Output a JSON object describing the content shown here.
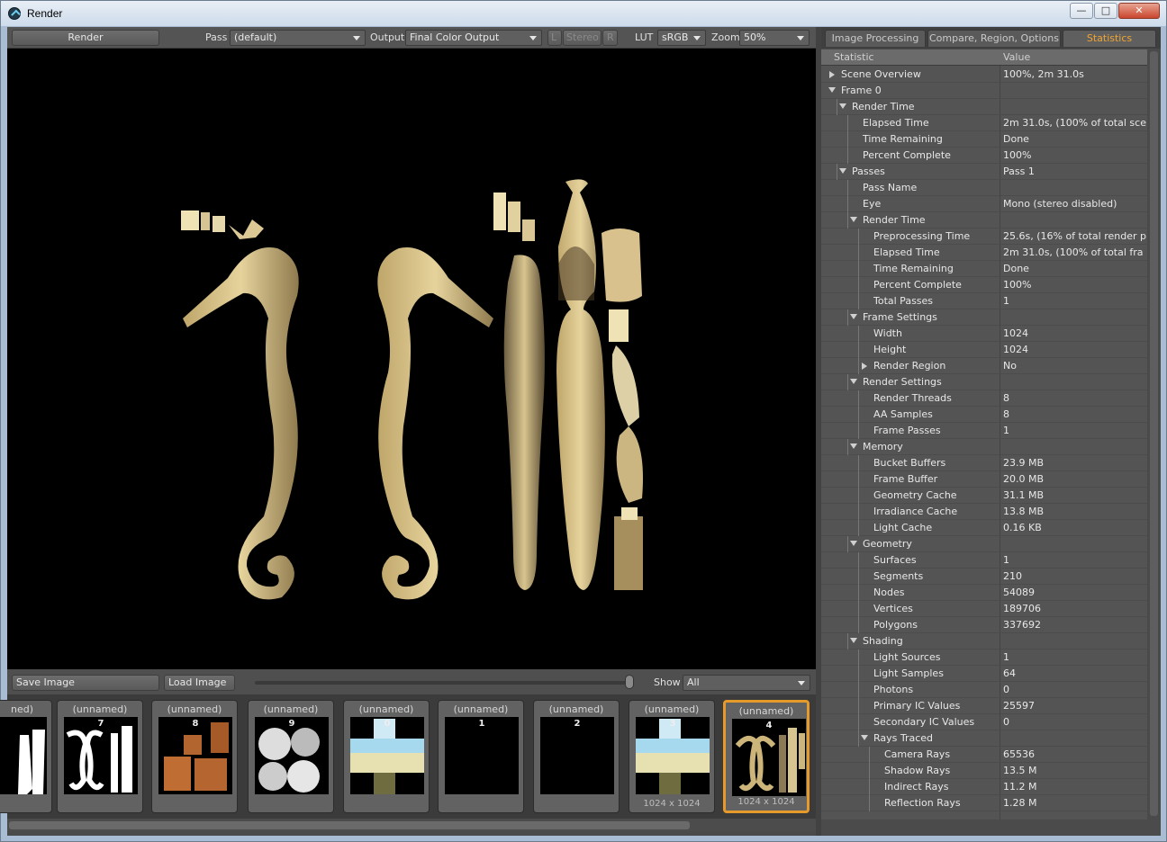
{
  "window": {
    "title": "Render",
    "min": "—",
    "max": "□",
    "close": "✕"
  },
  "toolbar": {
    "render_button": "Render",
    "pass_label": "Pass",
    "pass_value": "(default)",
    "output_label": "Output",
    "output_value": "Final Color Output",
    "l_label": "L",
    "stereo_label": "Stereo",
    "r_label": "R",
    "lut_label": "LUT",
    "lut_value": "sRGB",
    "zoom_label": "Zoom",
    "zoom_value": "50%"
  },
  "bottom": {
    "save": "Save Image",
    "load": "Load Image",
    "show_label": "Show",
    "show_value": "All"
  },
  "thumbnails": [
    {
      "name": "ned)",
      "num": "",
      "size": ""
    },
    {
      "name": "(unnamed)",
      "num": "7",
      "size": ""
    },
    {
      "name": "(unnamed)",
      "num": "8",
      "size": ""
    },
    {
      "name": "(unnamed)",
      "num": "9",
      "size": ""
    },
    {
      "name": "(unnamed)",
      "num": "0",
      "size": ""
    },
    {
      "name": "(unnamed)",
      "num": "1",
      "size": ""
    },
    {
      "name": "(unnamed)",
      "num": "2",
      "size": ""
    },
    {
      "name": "(unnamed)",
      "num": "3",
      "size": "1024 x 1024"
    },
    {
      "name": "(unnamed)",
      "num": "4",
      "size": "1024 x 1024"
    }
  ],
  "tabs": [
    "Image Processing",
    "Compare, Region, Options",
    "Statistics"
  ],
  "stats": {
    "col_stat": "Statistic",
    "col_value": "Value",
    "rows": [
      {
        "label": "Scene Overview",
        "value": "100%, 2m 31.0s",
        "depth": 0,
        "tw": "closed"
      },
      {
        "label": "Frame 0",
        "value": "",
        "depth": 0,
        "tw": "open"
      },
      {
        "label": "Render Time",
        "value": "",
        "depth": 1,
        "tw": "open"
      },
      {
        "label": "Elapsed Time",
        "value": "2m 31.0s, (100% of total sce ...",
        "depth": 2,
        "tw": ""
      },
      {
        "label": "Time Remaining",
        "value": "Done",
        "depth": 2,
        "tw": ""
      },
      {
        "label": "Percent Complete",
        "value": "100%",
        "depth": 2,
        "tw": ""
      },
      {
        "label": "Passes",
        "value": "Pass 1",
        "depth": 1,
        "tw": "open"
      },
      {
        "label": "Pass Name",
        "value": "",
        "depth": 2,
        "tw": ""
      },
      {
        "label": "Eye",
        "value": "Mono (stereo disabled)",
        "depth": 2,
        "tw": ""
      },
      {
        "label": "Render Time",
        "value": "",
        "depth": 2,
        "tw": "open"
      },
      {
        "label": "Preprocessing Time",
        "value": "25.6s, (16% of total render p ...",
        "depth": 3,
        "tw": ""
      },
      {
        "label": "Elapsed Time",
        "value": "2m 31.0s, (100% of total fra ...",
        "depth": 3,
        "tw": ""
      },
      {
        "label": "Time Remaining",
        "value": "Done",
        "depth": 3,
        "tw": ""
      },
      {
        "label": "Percent Complete",
        "value": "100%",
        "depth": 3,
        "tw": ""
      },
      {
        "label": "Total Passes",
        "value": "1",
        "depth": 3,
        "tw": ""
      },
      {
        "label": "Frame Settings",
        "value": "",
        "depth": 2,
        "tw": "open"
      },
      {
        "label": "Width",
        "value": "1024",
        "depth": 3,
        "tw": ""
      },
      {
        "label": "Height",
        "value": "1024",
        "depth": 3,
        "tw": ""
      },
      {
        "label": "Render Region",
        "value": "No",
        "depth": 3,
        "tw": "closed"
      },
      {
        "label": "Render Settings",
        "value": "",
        "depth": 2,
        "tw": "open"
      },
      {
        "label": "Render Threads",
        "value": "8",
        "depth": 3,
        "tw": ""
      },
      {
        "label": "AA Samples",
        "value": "8",
        "depth": 3,
        "tw": ""
      },
      {
        "label": "Frame Passes",
        "value": "1",
        "depth": 3,
        "tw": ""
      },
      {
        "label": "Memory",
        "value": "",
        "depth": 2,
        "tw": "open"
      },
      {
        "label": "Bucket Buffers",
        "value": "23.9 MB",
        "depth": 3,
        "tw": ""
      },
      {
        "label": "Frame Buffer",
        "value": "20.0 MB",
        "depth": 3,
        "tw": ""
      },
      {
        "label": "Geometry Cache",
        "value": "31.1 MB",
        "depth": 3,
        "tw": ""
      },
      {
        "label": "Irradiance Cache",
        "value": "13.8 MB",
        "depth": 3,
        "tw": ""
      },
      {
        "label": "Light Cache",
        "value": "0.16 KB",
        "depth": 3,
        "tw": ""
      },
      {
        "label": "Geometry",
        "value": "",
        "depth": 2,
        "tw": "open"
      },
      {
        "label": "Surfaces",
        "value": "1",
        "depth": 3,
        "tw": ""
      },
      {
        "label": "Segments",
        "value": "210",
        "depth": 3,
        "tw": ""
      },
      {
        "label": "Nodes",
        "value": "54089",
        "depth": 3,
        "tw": ""
      },
      {
        "label": "Vertices",
        "value": "189706",
        "depth": 3,
        "tw": ""
      },
      {
        "label": "Polygons",
        "value": "337692",
        "depth": 3,
        "tw": ""
      },
      {
        "label": "Shading",
        "value": "",
        "depth": 2,
        "tw": "open"
      },
      {
        "label": "Light Sources",
        "value": "1",
        "depth": 3,
        "tw": ""
      },
      {
        "label": "Light Samples",
        "value": "64",
        "depth": 3,
        "tw": ""
      },
      {
        "label": "Photons",
        "value": "0",
        "depth": 3,
        "tw": ""
      },
      {
        "label": "Primary IC Values",
        "value": "25597",
        "depth": 3,
        "tw": ""
      },
      {
        "label": "Secondary IC Values",
        "value": "0",
        "depth": 3,
        "tw": ""
      },
      {
        "label": "Rays Traced",
        "value": "",
        "depth": 3,
        "tw": "open"
      },
      {
        "label": "Camera Rays",
        "value": "65536",
        "depth": 4,
        "tw": ""
      },
      {
        "label": "Shadow Rays",
        "value": "13.5 M",
        "depth": 4,
        "tw": ""
      },
      {
        "label": "Indirect Rays",
        "value": "11.2 M",
        "depth": 4,
        "tw": ""
      },
      {
        "label": "Reflection Rays",
        "value": "1.28 M",
        "depth": 4,
        "tw": ""
      }
    ]
  }
}
